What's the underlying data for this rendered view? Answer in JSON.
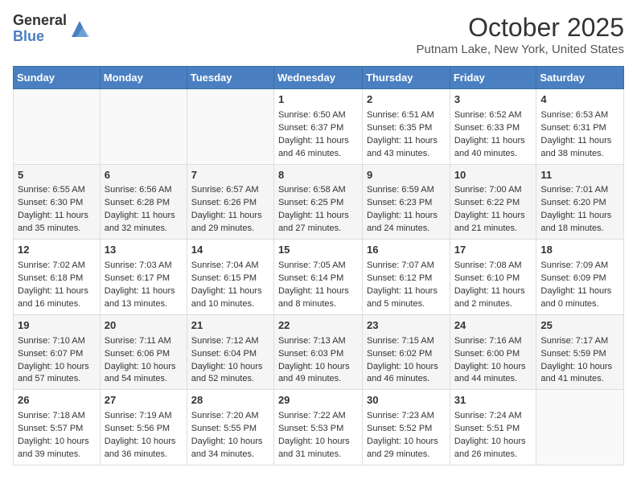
{
  "header": {
    "logo_general": "General",
    "logo_blue": "Blue",
    "title": "October 2025",
    "location": "Putnam Lake, New York, United States"
  },
  "days_of_week": [
    "Sunday",
    "Monday",
    "Tuesday",
    "Wednesday",
    "Thursday",
    "Friday",
    "Saturday"
  ],
  "weeks": [
    [
      {
        "day": "",
        "info": ""
      },
      {
        "day": "",
        "info": ""
      },
      {
        "day": "",
        "info": ""
      },
      {
        "day": "1",
        "info": "Sunrise: 6:50 AM\nSunset: 6:37 PM\nDaylight: 11 hours and 46 minutes."
      },
      {
        "day": "2",
        "info": "Sunrise: 6:51 AM\nSunset: 6:35 PM\nDaylight: 11 hours and 43 minutes."
      },
      {
        "day": "3",
        "info": "Sunrise: 6:52 AM\nSunset: 6:33 PM\nDaylight: 11 hours and 40 minutes."
      },
      {
        "day": "4",
        "info": "Sunrise: 6:53 AM\nSunset: 6:31 PM\nDaylight: 11 hours and 38 minutes."
      }
    ],
    [
      {
        "day": "5",
        "info": "Sunrise: 6:55 AM\nSunset: 6:30 PM\nDaylight: 11 hours and 35 minutes."
      },
      {
        "day": "6",
        "info": "Sunrise: 6:56 AM\nSunset: 6:28 PM\nDaylight: 11 hours and 32 minutes."
      },
      {
        "day": "7",
        "info": "Sunrise: 6:57 AM\nSunset: 6:26 PM\nDaylight: 11 hours and 29 minutes."
      },
      {
        "day": "8",
        "info": "Sunrise: 6:58 AM\nSunset: 6:25 PM\nDaylight: 11 hours and 27 minutes."
      },
      {
        "day": "9",
        "info": "Sunrise: 6:59 AM\nSunset: 6:23 PM\nDaylight: 11 hours and 24 minutes."
      },
      {
        "day": "10",
        "info": "Sunrise: 7:00 AM\nSunset: 6:22 PM\nDaylight: 11 hours and 21 minutes."
      },
      {
        "day": "11",
        "info": "Sunrise: 7:01 AM\nSunset: 6:20 PM\nDaylight: 11 hours and 18 minutes."
      }
    ],
    [
      {
        "day": "12",
        "info": "Sunrise: 7:02 AM\nSunset: 6:18 PM\nDaylight: 11 hours and 16 minutes."
      },
      {
        "day": "13",
        "info": "Sunrise: 7:03 AM\nSunset: 6:17 PM\nDaylight: 11 hours and 13 minutes."
      },
      {
        "day": "14",
        "info": "Sunrise: 7:04 AM\nSunset: 6:15 PM\nDaylight: 11 hours and 10 minutes."
      },
      {
        "day": "15",
        "info": "Sunrise: 7:05 AM\nSunset: 6:14 PM\nDaylight: 11 hours and 8 minutes."
      },
      {
        "day": "16",
        "info": "Sunrise: 7:07 AM\nSunset: 6:12 PM\nDaylight: 11 hours and 5 minutes."
      },
      {
        "day": "17",
        "info": "Sunrise: 7:08 AM\nSunset: 6:10 PM\nDaylight: 11 hours and 2 minutes."
      },
      {
        "day": "18",
        "info": "Sunrise: 7:09 AM\nSunset: 6:09 PM\nDaylight: 11 hours and 0 minutes."
      }
    ],
    [
      {
        "day": "19",
        "info": "Sunrise: 7:10 AM\nSunset: 6:07 PM\nDaylight: 10 hours and 57 minutes."
      },
      {
        "day": "20",
        "info": "Sunrise: 7:11 AM\nSunset: 6:06 PM\nDaylight: 10 hours and 54 minutes."
      },
      {
        "day": "21",
        "info": "Sunrise: 7:12 AM\nSunset: 6:04 PM\nDaylight: 10 hours and 52 minutes."
      },
      {
        "day": "22",
        "info": "Sunrise: 7:13 AM\nSunset: 6:03 PM\nDaylight: 10 hours and 49 minutes."
      },
      {
        "day": "23",
        "info": "Sunrise: 7:15 AM\nSunset: 6:02 PM\nDaylight: 10 hours and 46 minutes."
      },
      {
        "day": "24",
        "info": "Sunrise: 7:16 AM\nSunset: 6:00 PM\nDaylight: 10 hours and 44 minutes."
      },
      {
        "day": "25",
        "info": "Sunrise: 7:17 AM\nSunset: 5:59 PM\nDaylight: 10 hours and 41 minutes."
      }
    ],
    [
      {
        "day": "26",
        "info": "Sunrise: 7:18 AM\nSunset: 5:57 PM\nDaylight: 10 hours and 39 minutes."
      },
      {
        "day": "27",
        "info": "Sunrise: 7:19 AM\nSunset: 5:56 PM\nDaylight: 10 hours and 36 minutes."
      },
      {
        "day": "28",
        "info": "Sunrise: 7:20 AM\nSunset: 5:55 PM\nDaylight: 10 hours and 34 minutes."
      },
      {
        "day": "29",
        "info": "Sunrise: 7:22 AM\nSunset: 5:53 PM\nDaylight: 10 hours and 31 minutes."
      },
      {
        "day": "30",
        "info": "Sunrise: 7:23 AM\nSunset: 5:52 PM\nDaylight: 10 hours and 29 minutes."
      },
      {
        "day": "31",
        "info": "Sunrise: 7:24 AM\nSunset: 5:51 PM\nDaylight: 10 hours and 26 minutes."
      },
      {
        "day": "",
        "info": ""
      }
    ]
  ]
}
